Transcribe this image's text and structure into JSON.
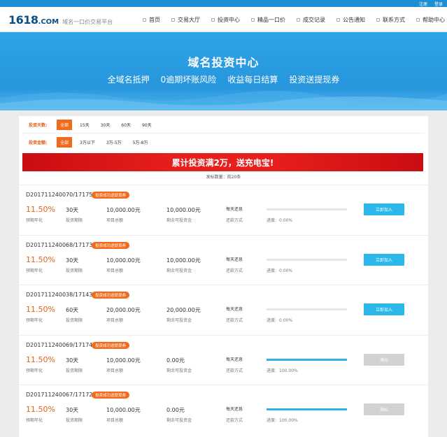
{
  "topbar": {
    "register": "注册",
    "login": "登录"
  },
  "header": {
    "logo_num": "1618",
    "logo_com": ".COM",
    "tagline": "域名一口价交易平台",
    "nav": [
      "首页",
      "交易大厅",
      "投资中心",
      "精品一口价",
      "成交记录",
      "公告通知",
      "联系方式",
      "帮助中心"
    ]
  },
  "banner": {
    "title": "域名投资中心",
    "subtitles": [
      "全域名抵押",
      "0逾期坏账风险",
      "收益每日结算",
      "投资送提现券"
    ]
  },
  "filters": {
    "days": {
      "label": "投资天数:",
      "options": [
        "全部",
        "15天",
        "30天",
        "60天",
        "90天"
      ],
      "active": 0
    },
    "amount": {
      "label": "投资金额:",
      "options": [
        "全部",
        "3万以下",
        "3万-5万",
        "5万-8万"
      ],
      "active": 0
    }
  },
  "promo": "累计投资满2万，送充电宝!",
  "count_text": "发标数量：前20条",
  "labels": {
    "rate": "预期年化",
    "term": "投资期限",
    "total": "项目总额",
    "remain": "剩余可投资金",
    "method": "还款方式",
    "progress_prefix": "进度:"
  },
  "items": [
    {
      "id": "D201711240070/17175",
      "tag": "投资成功送提现券",
      "rate": "11.50%",
      "term": "30天",
      "total": "10,000.00元",
      "remain": "10,000.00元",
      "method": "每天还息",
      "progress": 0,
      "progress_text": "0.00%",
      "button": "立即加入",
      "status": "open"
    },
    {
      "id": "D201711240068/17173",
      "tag": "投资成功送提现券",
      "rate": "11.50%",
      "term": "30天",
      "total": "10,000.00元",
      "remain": "10,000.00元",
      "method": "每天还息",
      "progress": 0,
      "progress_text": "0.00%",
      "button": "立即加入",
      "status": "open"
    },
    {
      "id": "D201711240038/17143",
      "tag": "投资成功送提现券",
      "rate": "11.50%",
      "term": "60天",
      "total": "20,000.00元",
      "remain": "20,000.00元",
      "method": "每天还息",
      "progress": 0,
      "progress_text": "0.00%",
      "button": "立即加入",
      "status": "open"
    },
    {
      "id": "D201711240069/17174",
      "tag": "投资成功送提现券",
      "rate": "11.50%",
      "term": "30天",
      "total": "10,000.00元",
      "remain": "0.00元",
      "method": "每天还息",
      "progress": 1,
      "progress_text": "100.00%",
      "button": "满标",
      "status": "full"
    },
    {
      "id": "D201711240067/17172",
      "tag": "投资成功送提现券",
      "rate": "11.50%",
      "term": "30天",
      "total": "10,000.00元",
      "remain": "0.00元",
      "method": "每天还息",
      "progress": 1,
      "progress_text": "100.00%",
      "button": "满标",
      "status": "full"
    }
  ],
  "colors": {
    "brand_blue": "#1f8fd3",
    "accent_orange": "#f26b1d",
    "promo_red": "#e8201d",
    "button_blue": "#2bb7e9"
  }
}
